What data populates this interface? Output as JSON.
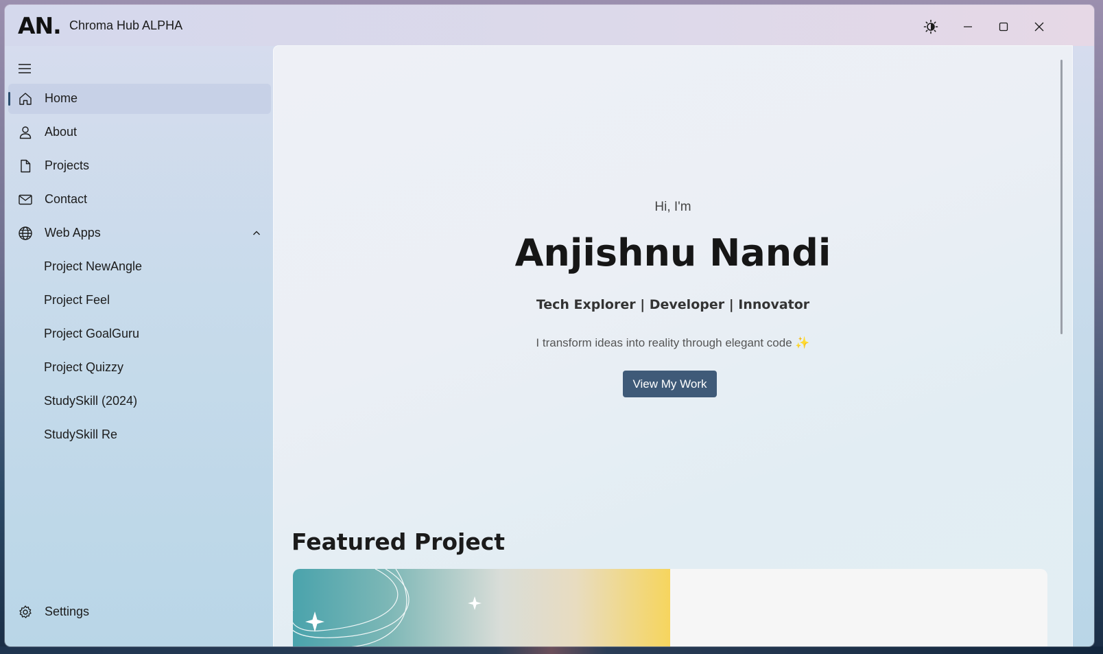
{
  "window": {
    "logo": "AN.",
    "title": "Chroma Hub ALPHA"
  },
  "titlebar_controls": [
    "theme-toggle",
    "minimize",
    "maximize",
    "close"
  ],
  "sidebar": {
    "items": [
      {
        "label": "Home",
        "icon": "home-icon",
        "selected": true
      },
      {
        "label": "About",
        "icon": "person-icon"
      },
      {
        "label": "Projects",
        "icon": "document-icon"
      },
      {
        "label": "Contact",
        "icon": "mail-icon"
      },
      {
        "label": "Web Apps",
        "icon": "globe-icon",
        "expanded": true
      }
    ],
    "subitems": [
      "Project NewAngle",
      "Project Feel",
      "Project GoalGuru",
      "Project Quizzy",
      "StudySkill (2024)",
      "StudySkill Re"
    ],
    "settings_label": "Settings"
  },
  "hero": {
    "greeting": "Hi, I'm",
    "name": "Anjishnu Nandi",
    "tagline": "Tech Explorer | Developer | Innovator",
    "description": "I transform ideas into reality through elegant code ✨",
    "cta_label": "View My Work"
  },
  "featured": {
    "title": "Featured Project"
  },
  "colors": {
    "accent": "#3f5a78",
    "indicator": "#2b4d6e"
  }
}
